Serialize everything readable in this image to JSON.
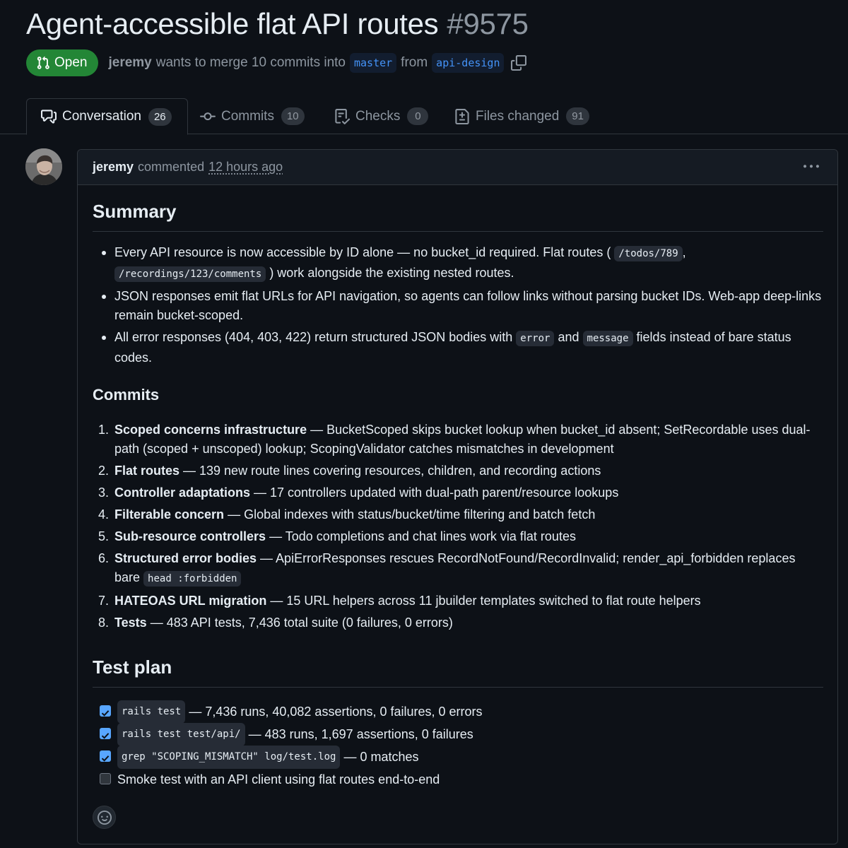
{
  "pr": {
    "title": "Agent-accessible flat API routes",
    "number": "#9575",
    "state": "Open",
    "author": "jeremy",
    "merge_text": "wants to merge 10 commits into",
    "base_branch": "master",
    "from_text": "from",
    "head_branch": "api-design"
  },
  "tabs": [
    {
      "label": "Conversation",
      "count": "26",
      "icon": "comment-discussion-icon"
    },
    {
      "label": "Commits",
      "count": "10",
      "icon": "git-commit-icon"
    },
    {
      "label": "Checks",
      "count": "0",
      "icon": "checklist-icon"
    },
    {
      "label": "Files changed",
      "count": "91",
      "icon": "file-diff-icon"
    }
  ],
  "comment": {
    "author": "jeremy",
    "action": "commented",
    "time": "12 hours ago",
    "menu_icon": "kebab-horizontal-icon"
  },
  "summary": {
    "heading": "Summary",
    "items": [
      {
        "p1": "Every API resource is now accessible by ID alone — no bucket_id required. Flat routes (",
        "c1": "/todos/789",
        "p2": ",",
        "c2": "/recordings/123/comments",
        "p3": ") work alongside the existing nested routes."
      },
      {
        "p1": "JSON responses emit flat URLs for API navigation, so agents can follow links without parsing bucket IDs. Web-app deep-links remain bucket-scoped."
      },
      {
        "p1": "All error responses (404, 403, 422) return structured JSON bodies with",
        "c1": "error",
        "p2": "and",
        "c2": "message",
        "p3": "fields instead of bare status codes."
      }
    ]
  },
  "commits": {
    "heading": "Commits",
    "items": [
      {
        "n": "1.",
        "title": "Scoped concerns infrastructure",
        "text": " — BucketScoped skips bucket lookup when bucket_id absent; SetRecordable uses dual-path (scoped + unscoped) lookup; ScopingValidator catches mismatches in development"
      },
      {
        "n": "2.",
        "title": "Flat routes",
        "text": " — 139 new route lines covering resources, children, and recording actions"
      },
      {
        "n": "3.",
        "title": "Controller adaptations",
        "text": " — 17 controllers updated with dual-path parent/resource lookups"
      },
      {
        "n": "4.",
        "title": "Filterable concern",
        "text": " — Global indexes with status/bucket/time filtering and batch fetch"
      },
      {
        "n": "5.",
        "title": "Sub-resource controllers",
        "text": " — Todo completions and chat lines work via flat routes"
      },
      {
        "n": "6.",
        "title": "Structured error bodies",
        "text": " — ApiErrorResponses rescues RecordNotFound/RecordInvalid; render_api_forbidden replaces bare",
        "code": "head :forbidden"
      },
      {
        "n": "7.",
        "title": "HATEOAS URL migration",
        "text": " — 15 URL helpers across 11 jbuilder templates switched to flat route helpers"
      },
      {
        "n": "8.",
        "title": "Tests",
        "text": " — 483 API tests, 7,436 total suite (0 failures, 0 errors)"
      }
    ]
  },
  "test_plan": {
    "heading": "Test plan",
    "items": [
      {
        "checked": true,
        "code": "rails test",
        "text": "— 7,436 runs, 40,082 assertions, 0 failures, 0 errors"
      },
      {
        "checked": true,
        "code": "rails test test/api/",
        "text": "— 483 runs, 1,697 assertions, 0 failures"
      },
      {
        "checked": true,
        "code": "grep \"SCOPING_MISMATCH\" log/test.log",
        "text": "— 0 matches"
      },
      {
        "checked": false,
        "code": "",
        "text": "Smoke test with an API client using flat routes end-to-end"
      }
    ]
  },
  "colors": {
    "background": "#0d1117",
    "open_badge": "#238636",
    "link_blue": "#4493f8",
    "checkbox_checked": "#58a6ff"
  }
}
